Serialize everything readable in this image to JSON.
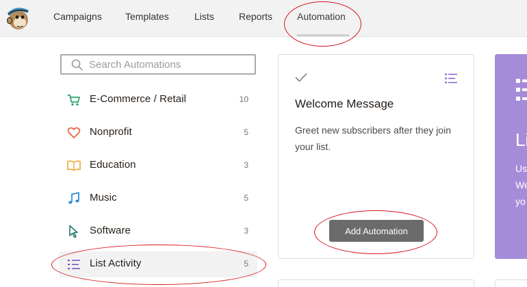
{
  "nav": {
    "items": [
      "Campaigns",
      "Templates",
      "Lists",
      "Reports",
      "Automation"
    ],
    "active": "Automation"
  },
  "search": {
    "placeholder": "Search Automations"
  },
  "categories": [
    {
      "label": "E-Commerce / Retail",
      "count": "10",
      "icon": "cart-icon",
      "color": "#27a065"
    },
    {
      "label": "Nonprofit",
      "count": "5",
      "icon": "heart-icon",
      "color": "#e8603c"
    },
    {
      "label": "Education",
      "count": "3",
      "icon": "book-icon",
      "color": "#f0a92f"
    },
    {
      "label": "Music",
      "count": "5",
      "icon": "music-note-icon",
      "color": "#2e8bd0"
    },
    {
      "label": "Software",
      "count": "3",
      "icon": "cursor-icon",
      "color": "#1f7a6b"
    },
    {
      "label": "List Activity",
      "count": "5",
      "icon": "list-icon",
      "color": "#7b56c8"
    }
  ],
  "card": {
    "title": "Welcome Message",
    "description": "Greet new subscribers after they join your list.",
    "button": "Add Automation"
  },
  "promo": {
    "heading": "Li",
    "text": "Us\nWe\nyo"
  },
  "colors": {
    "annotation": "#d6141c",
    "accent_purple": "#7b56c8",
    "promo_bg": "#a58cd9",
    "button_bg": "#6b6b6b"
  }
}
